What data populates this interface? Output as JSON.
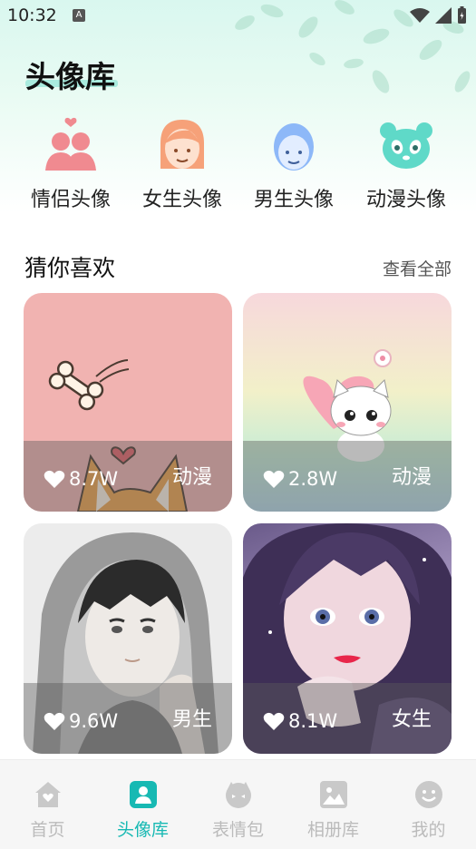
{
  "status_bar": {
    "time": "10:32",
    "notif_icon": "a-icon",
    "wifi_icon": "wifi-icon",
    "signal_icon": "signal-icon",
    "battery_icon": "battery-icon"
  },
  "page": {
    "title": "头像库"
  },
  "categories": [
    {
      "label": "情侣头像",
      "icon": "couple-icon",
      "color": "#f08a90"
    },
    {
      "label": "女生头像",
      "icon": "girl-icon",
      "color": "#f6a179"
    },
    {
      "label": "男生头像",
      "icon": "boy-icon",
      "color": "#8db8f8"
    },
    {
      "label": "动漫头像",
      "icon": "panda-icon",
      "color": "#5fd9c8"
    }
  ],
  "section": {
    "title": "猜你喜欢",
    "more": "查看全部"
  },
  "cards": [
    {
      "likes": "8.7W",
      "tag": "动漫"
    },
    {
      "likes": "2.8W",
      "tag": "动漫"
    },
    {
      "likes": "9.6W",
      "tag": "男生"
    },
    {
      "likes": "8.1W",
      "tag": "女生"
    }
  ],
  "bottom_nav": [
    {
      "label": "首页",
      "icon": "home-icon",
      "active": false
    },
    {
      "label": "头像库",
      "icon": "avatar-library-icon",
      "active": true
    },
    {
      "label": "表情包",
      "icon": "sticker-icon",
      "active": false
    },
    {
      "label": "相册库",
      "icon": "album-icon",
      "active": false
    },
    {
      "label": "我的",
      "icon": "profile-icon",
      "active": false
    }
  ],
  "colors": {
    "accent": "#17b9b3",
    "inactive": "#bbbbbb"
  }
}
